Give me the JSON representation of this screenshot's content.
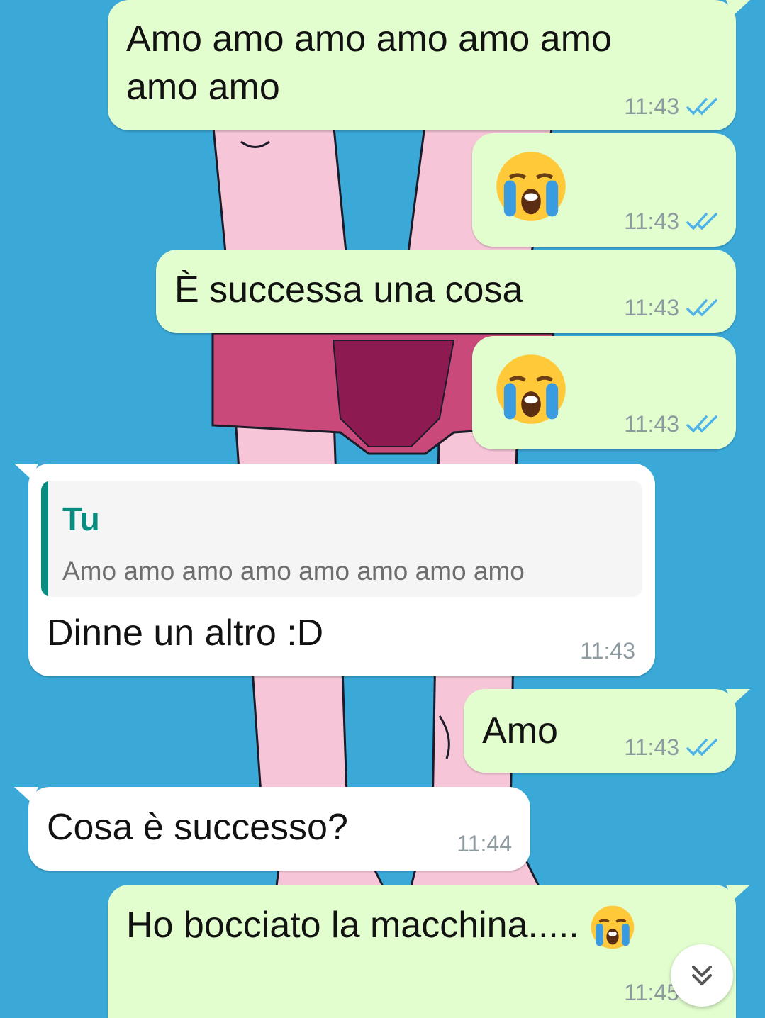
{
  "colors": {
    "background": "#3aa9d8",
    "outgoing_bubble": "#e2fecf",
    "incoming_bubble": "#ffffff",
    "read_ticks": "#4fb2e8",
    "quote_accent": "#078c7f",
    "timestamp": "#8d9aa0"
  },
  "messages": [
    {
      "direction": "outgoing",
      "text": "Amo amo amo amo amo amo",
      "text_line2": "amo amo",
      "time": "11:43",
      "status": "read"
    },
    {
      "direction": "outgoing",
      "emoji": "loudly-crying-face",
      "time": "11:43",
      "status": "read"
    },
    {
      "direction": "outgoing",
      "text": "È successa una cosa",
      "time": "11:43",
      "status": "read"
    },
    {
      "direction": "outgoing",
      "emoji": "loudly-crying-face",
      "time": "11:43",
      "status": "read"
    },
    {
      "direction": "incoming",
      "quote": {
        "author": "Tu",
        "text": "Amo amo amo amo amo amo amo amo"
      },
      "text": "Dinne un altro :D",
      "time": "11:43"
    },
    {
      "direction": "outgoing",
      "text": "Amo",
      "time": "11:43",
      "status": "read"
    },
    {
      "direction": "incoming",
      "text": "Cosa è successo?",
      "time": "11:44"
    },
    {
      "direction": "outgoing",
      "text": "Ho bocciato la macchina.....",
      "emoji": "loudly-crying-face",
      "time": "11:45",
      "status": "read"
    }
  ],
  "scroll_button": {
    "icon": "double-chevron-down-icon"
  }
}
